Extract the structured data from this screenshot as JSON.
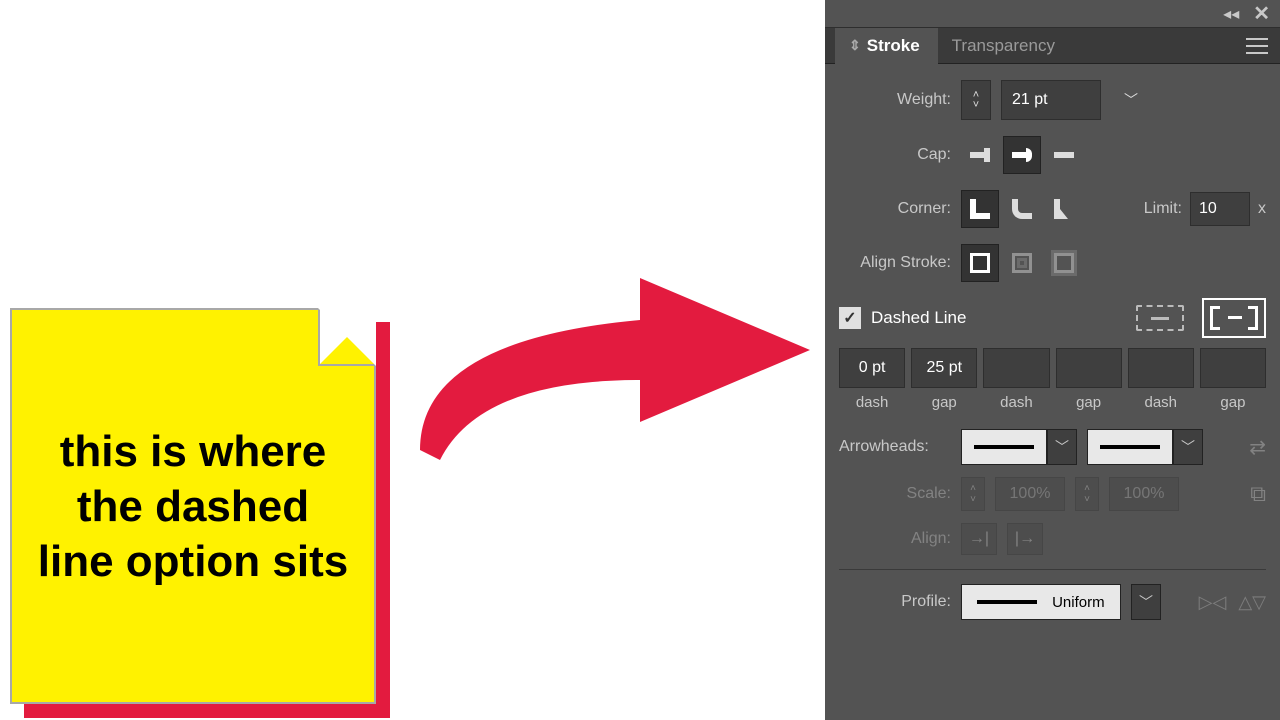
{
  "note": {
    "text": "this is where the dashed line option sits"
  },
  "panel": {
    "tabs": {
      "stroke": "Stroke",
      "transparency": "Transparency"
    },
    "weight": {
      "label": "Weight:",
      "value": "21 pt"
    },
    "cap": {
      "label": "Cap:"
    },
    "corner": {
      "label": "Corner:"
    },
    "limit": {
      "label": "Limit:",
      "value": "10",
      "unit": "x"
    },
    "alignStroke": {
      "label": "Align Stroke:"
    },
    "dashed": {
      "label": "Dashed Line",
      "checked": "✓"
    },
    "dashInputs": {
      "v1": "0 pt",
      "v2": "25 pt",
      "v3": "",
      "v4": "",
      "v5": "",
      "v6": "",
      "l1": "dash",
      "l2": "gap",
      "l3": "dash",
      "l4": "gap",
      "l5": "dash",
      "l6": "gap"
    },
    "arrowheads": {
      "label": "Arrowheads:"
    },
    "scale": {
      "label": "Scale:",
      "v1": "100%",
      "v2": "100%"
    },
    "alignAh": {
      "label": "Align:"
    },
    "profile": {
      "label": "Profile:",
      "value": "Uniform"
    }
  }
}
